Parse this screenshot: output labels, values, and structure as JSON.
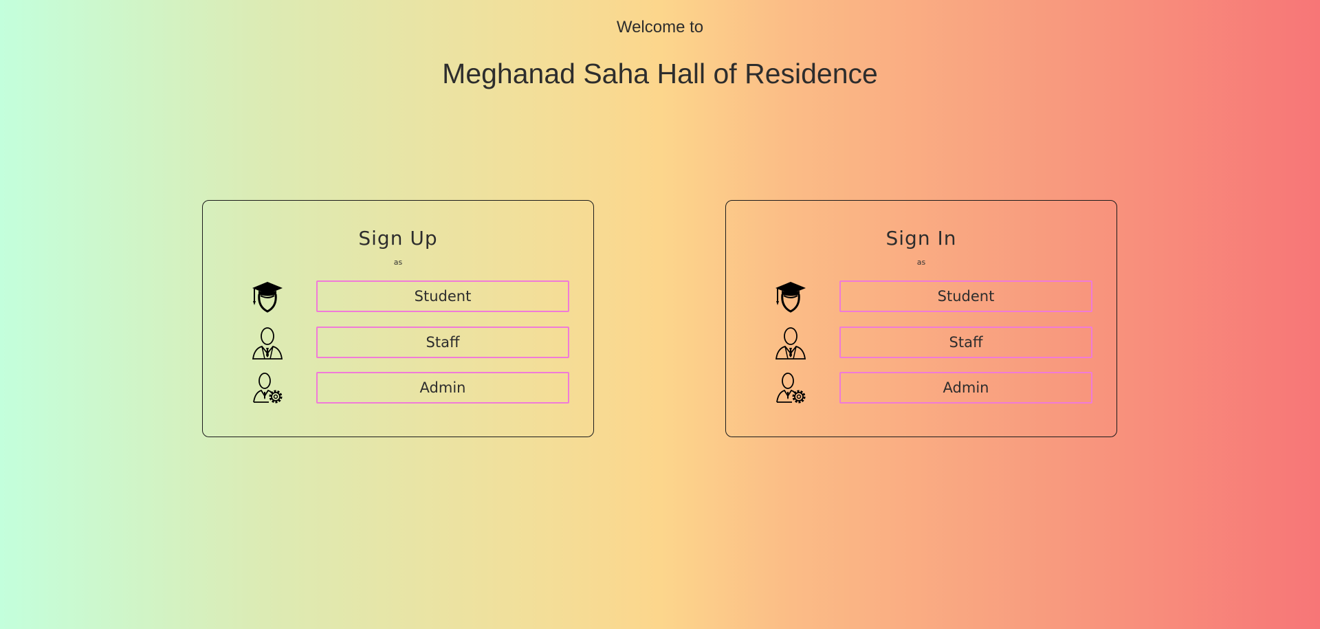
{
  "header": {
    "welcome": "Welcome to",
    "title": "Meghanad Saha Hall of Residence"
  },
  "signup": {
    "title": "Sign Up",
    "subtitle": "as",
    "roles": [
      {
        "label": "Student",
        "icon": "graduate-icon"
      },
      {
        "label": "Staff",
        "icon": "staff-icon"
      },
      {
        "label": "Admin",
        "icon": "admin-icon"
      }
    ]
  },
  "signin": {
    "title": "Sign In",
    "subtitle": "as",
    "roles": [
      {
        "label": "Student",
        "icon": "graduate-icon"
      },
      {
        "label": "Staff",
        "icon": "staff-icon"
      },
      {
        "label": "Admin",
        "icon": "admin-icon"
      }
    ]
  },
  "colors": {
    "button_border": "#f07ad8",
    "gradient_left": "#c3ffdc",
    "gradient_mid": "#fcd68c",
    "gradient_right": "#f77677"
  }
}
